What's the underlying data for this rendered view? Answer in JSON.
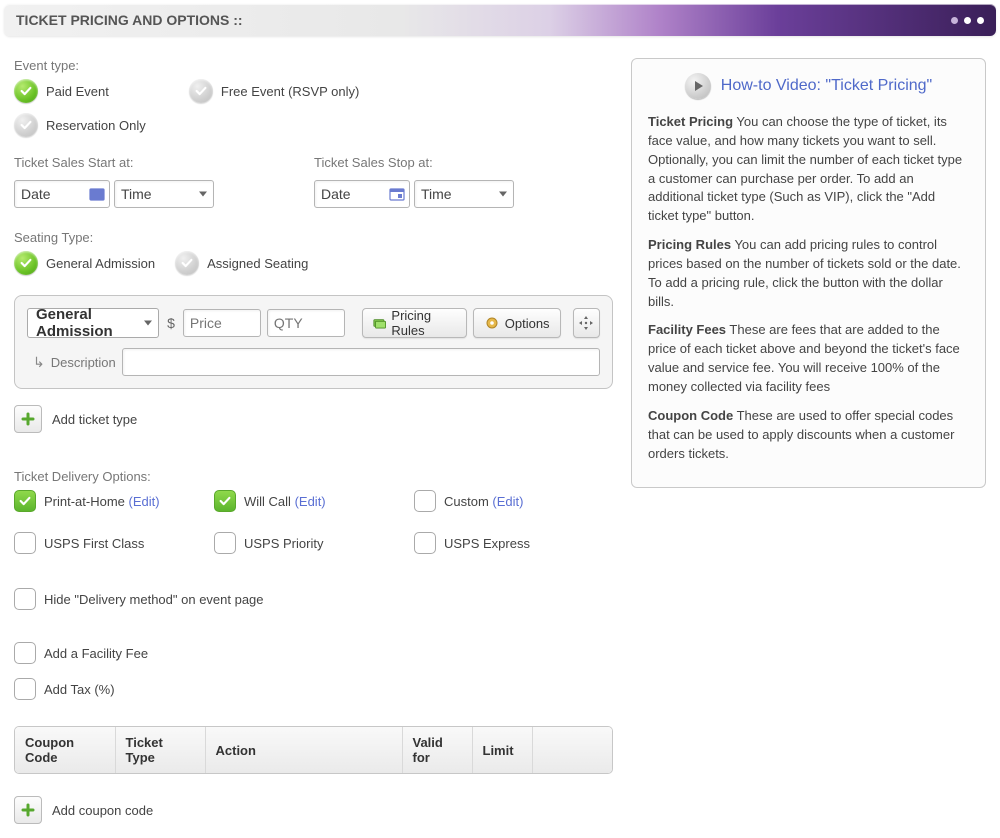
{
  "header": {
    "title": "TICKET PRICING AND OPTIONS ::"
  },
  "event_type": {
    "label": "Event type:",
    "paid": "Paid Event",
    "free": "Free Event (RSVP only)",
    "reservation": "Reservation Only"
  },
  "sales": {
    "start_label": "Ticket Sales Start at:",
    "stop_label": "Ticket Sales Stop at:",
    "date": "Date",
    "time": "Time"
  },
  "seating": {
    "label": "Seating Type:",
    "general": "General Admission",
    "assigned": "Assigned Seating"
  },
  "ticket": {
    "type_value": "General Admission",
    "currency": "$",
    "price_placeholder": "Price",
    "qty_placeholder": "QTY",
    "pricing_rules": "Pricing Rules",
    "options": "Options",
    "description": "Description"
  },
  "add_ticket": "Add ticket type",
  "delivery": {
    "label": "Ticket Delivery Options:",
    "print": "Print-at-Home",
    "willcall": "Will Call",
    "custom": "Custom",
    "usps_first": "USPS First Class",
    "usps_priority": "USPS Priority",
    "usps_express": "USPS Express",
    "edit": "(Edit)"
  },
  "misc": {
    "hide_delivery": "Hide \"Delivery method\" on event page",
    "facility_fee": "Add a Facility Fee",
    "tax": "Add Tax (%)"
  },
  "coupon_table": {
    "coupon": "Coupon Code",
    "ticket_type": "Ticket Type",
    "action": "Action",
    "valid_for": "Valid for",
    "limit": "Limit"
  },
  "add_coupon": "Add coupon code",
  "help": {
    "video": "How-to Video: \"Ticket Pricing\"",
    "tp_head": "Ticket Pricing",
    "tp_body": " You can choose the type of ticket, its face value, and how many tickets you want to sell. Optionally, you can limit the number of each ticket type a customer can purchase per order. To add an additional ticket type (Such as VIP), click the \"Add ticket type\" button.",
    "pr_head": "Pricing Rules",
    "pr_body": " You can add pricing rules to control prices based on the number of tickets sold or the date. To add a pricing rule, click the button with the dollar bills.",
    "ff_head": "Facility Fees",
    "ff_body": " These are fees that are added to the price of each ticket above and beyond the ticket's face value and service fee. You will receive 100% of the money collected via facility fees",
    "cc_head": "Coupon Code",
    "cc_body": " These are used to offer special codes that can be used to apply discounts when a customer orders tickets."
  }
}
